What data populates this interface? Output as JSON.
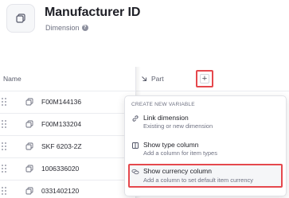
{
  "header": {
    "title": "Manufacturer ID",
    "subtitle": "Dimension",
    "help_glyph": "?"
  },
  "table": {
    "name_column_label": "Name",
    "part_column_label": "Part",
    "add_glyph": "+",
    "rows": [
      {
        "label": "F00M144136"
      },
      {
        "label": "F00M133204"
      },
      {
        "label": "SKF 6203-2Z"
      },
      {
        "label": "1006336020"
      },
      {
        "label": "0331402120"
      }
    ]
  },
  "menu": {
    "section_label": "CREATE NEW VARIABLE",
    "items": [
      {
        "title": "Link dimension",
        "description": "Existing or new dimension",
        "icon": "link-icon"
      },
      {
        "title": "Show type column",
        "description": "Add a column for item types",
        "icon": "type-column-icon"
      },
      {
        "title": "Show currency column",
        "description": "Add a column to set default item currency",
        "icon": "currency-icon"
      }
    ]
  },
  "colors": {
    "highlight": "#e5484d",
    "text_primary": "#1e1f26",
    "text_secondary": "#6d7080"
  }
}
